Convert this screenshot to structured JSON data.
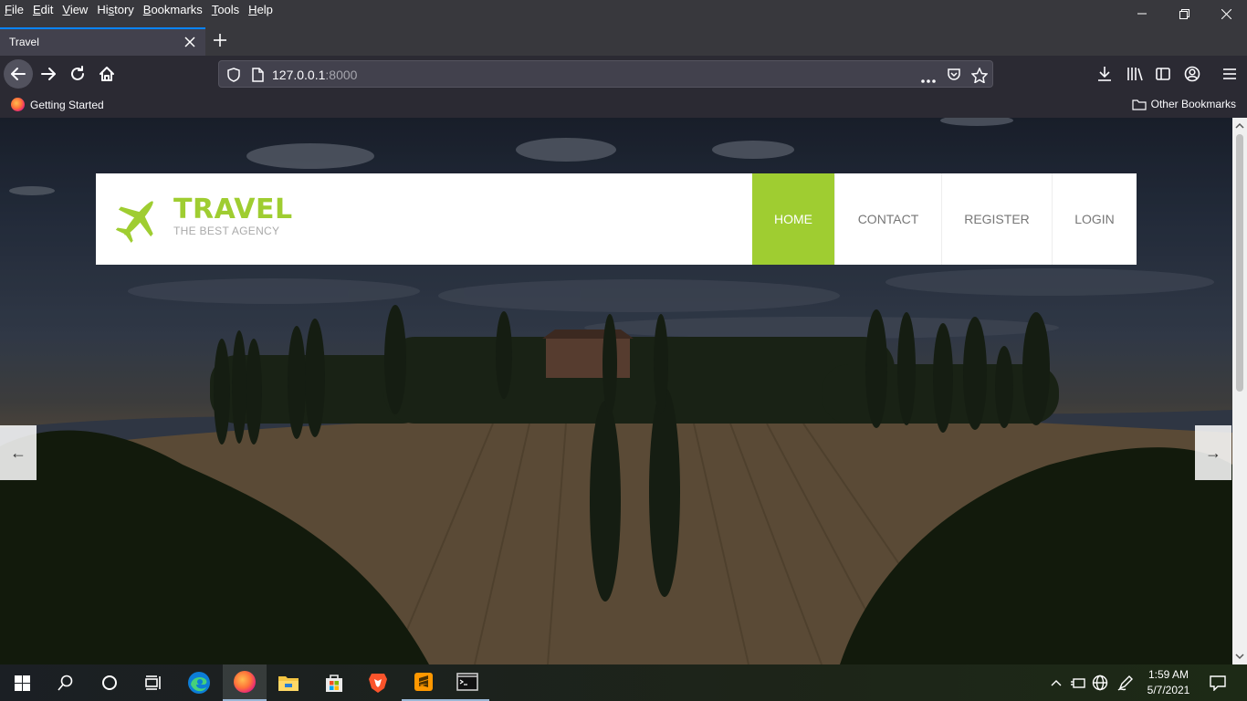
{
  "browser": {
    "menu": [
      {
        "label": "File",
        "key": "F",
        "rest": "ile"
      },
      {
        "label": "Edit",
        "key": "E",
        "rest": "dit"
      },
      {
        "label": "View",
        "key": "V",
        "rest": "iew"
      },
      {
        "label": "History",
        "key": "",
        "pre": "Hi",
        "keymid": "s",
        "rest": "tory"
      },
      {
        "label": "Bookmarks",
        "key": "B",
        "rest": "ookmarks"
      },
      {
        "label": "Tools",
        "key": "T",
        "rest": "ools"
      },
      {
        "label": "Help",
        "key": "H",
        "rest": "elp"
      }
    ],
    "tab_title": "Travel",
    "url_host": "127.0.0.1",
    "url_port": ":8000",
    "bookmarks": {
      "getting_started": "Getting Started",
      "other": "Other Bookmarks"
    }
  },
  "site": {
    "logo_title": "TRAVEL",
    "logo_subtitle": "THE BEST AGENCY",
    "nav": [
      "HOME",
      "CONTACT",
      "REGISTER",
      "LOGIN"
    ],
    "active_nav": "HOME",
    "accent_color": "#9fcd31",
    "slider_prev": "←",
    "slider_next": "→"
  },
  "taskbar": {
    "time": "1:59 AM",
    "date": "5/7/2021",
    "apps": [
      "start-icon",
      "search-icon",
      "cortana-icon",
      "task-view-icon",
      "edge-icon",
      "firefox-icon",
      "file-explorer-icon",
      "store-icon",
      "brave-icon",
      "sublime-text-icon",
      "terminal-icon"
    ]
  }
}
